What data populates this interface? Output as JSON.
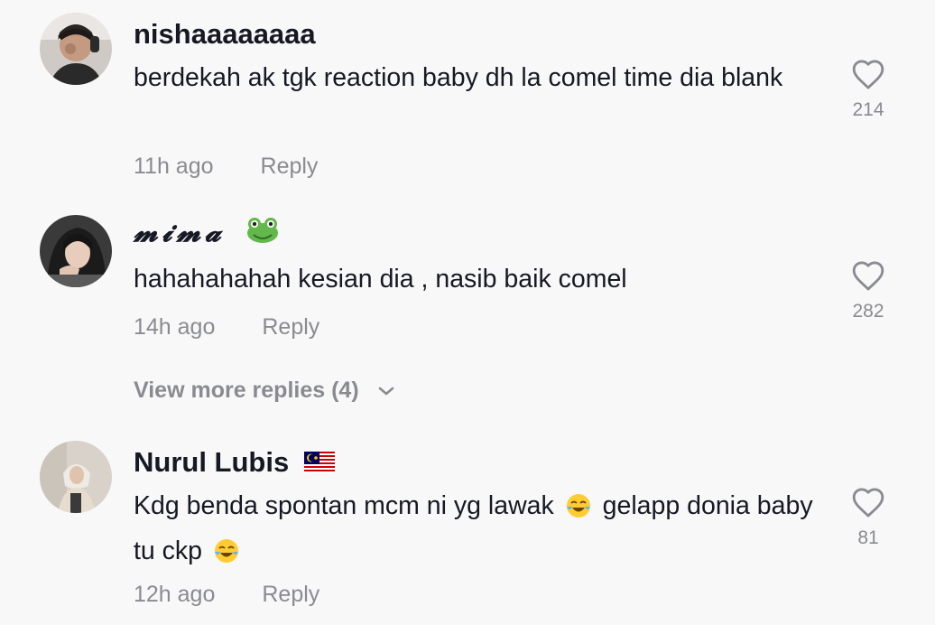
{
  "comments": [
    {
      "username": "nishaaaaaaaa",
      "text": "berdekah ak tgk reaction baby dh la comel time dia blank",
      "time": "11h ago",
      "reply_label": "Reply",
      "likes": "214"
    },
    {
      "username": "𝓶𝓲𝓶𝓪",
      "username_emoji": "frog-emoji",
      "text": "hahahahahah kesian dia , nasib baik comel",
      "time": "14h ago",
      "reply_label": "Reply",
      "likes": "282",
      "view_more": "View more replies (4)"
    },
    {
      "username": "Nurul Lubis",
      "username_emoji": "malaysia-flag-emoji",
      "text_part1": "Kdg benda spontan mcm ni yg lawak",
      "text_part2": "gelapp donia baby tu ckp",
      "text_emoji": "tears-of-joy-emoji",
      "time": "12h ago",
      "reply_label": "Reply",
      "likes": "81"
    }
  ],
  "icons": {
    "like": "heart-outline-icon",
    "expand": "chevron-down-icon"
  },
  "colors": {
    "text": "#161823",
    "secondary": "#8a8b91",
    "background": "#f8f8f8"
  }
}
